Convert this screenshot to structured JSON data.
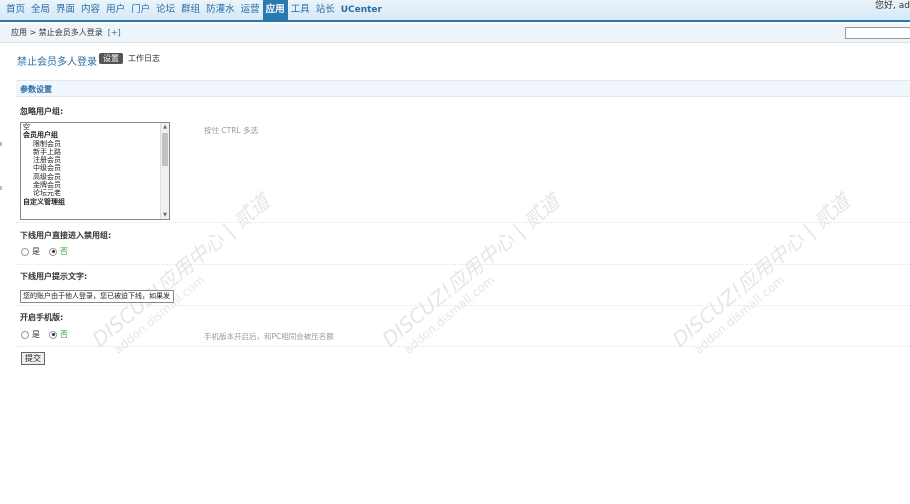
{
  "nav": {
    "items": [
      "首页",
      "全局",
      "界面",
      "内容",
      "用户",
      "门户",
      "论坛",
      "群组",
      "防灌水",
      "运营",
      "应用",
      "工具",
      "站长",
      "UCenter"
    ],
    "active": "应用",
    "greeting": "您好, ad"
  },
  "subbar": {
    "breadcrumb": "应用 > 禁止会员多人登录",
    "add_fav": "[+]"
  },
  "plugin": {
    "title": "禁止会员多人登录",
    "tab_settings": "设置",
    "tab_log": "工作日志"
  },
  "section": {
    "title": "参数设置"
  },
  "fields": {
    "ignore_groups": {
      "label": "忽略用户组:",
      "hint": "按住 CTRL 多选",
      "options": [
        "空",
        "会员用户组",
        "限制会员",
        "新手上路",
        "注册会员",
        "中级会员",
        "高级会员",
        "金牌会员",
        "论坛元老",
        "自定义管理组"
      ]
    },
    "ban_group": {
      "label": "下线用户直接进入禁用组:",
      "yes": "是",
      "no": "否",
      "selected": "否"
    },
    "notice_text": {
      "label": "下线用户提示文字:",
      "value": "您的账户由于他人登录，您已被迫下线，如果发"
    },
    "mobile": {
      "label": "开启手机版:",
      "yes": "是",
      "no": "否",
      "selected": "否",
      "hint": "手机版本开启后，和PC相同会被压名额"
    }
  },
  "submit_label": "提交",
  "watermark": {
    "line1": "DISCUZ!应用中心 | 贰道",
    "line2": "addon.dismall.com"
  }
}
